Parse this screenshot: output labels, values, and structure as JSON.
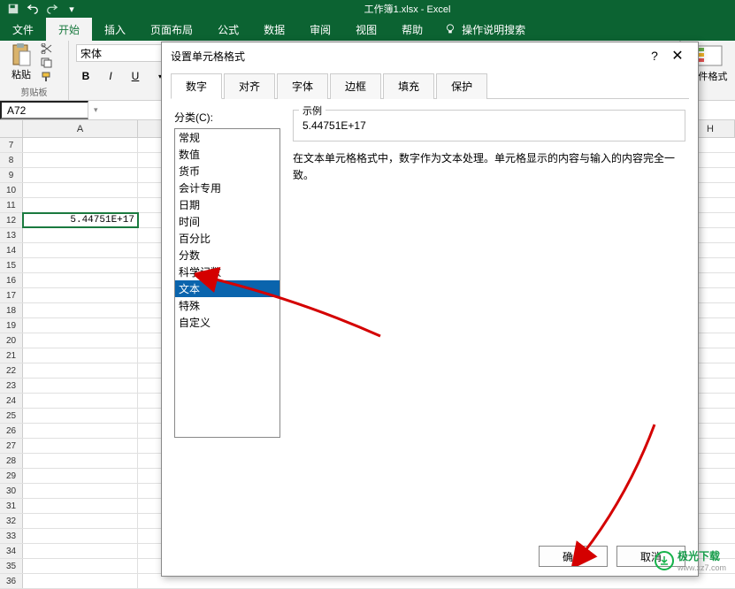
{
  "titlebar": {
    "doc_title": "工作簿1.xlsx - Excel"
  },
  "ribbon": {
    "tabs": [
      "文件",
      "开始",
      "插入",
      "页面布局",
      "公式",
      "数据",
      "审阅",
      "视图",
      "帮助"
    ],
    "active_tab": 1,
    "search_hint": "操作说明搜索",
    "clipboard": {
      "paste": "粘贴",
      "group_label": "剪贴板"
    },
    "font": {
      "name": "宋体",
      "bold": "B",
      "italic": "I",
      "underline": "U"
    },
    "cond_format": "条件格式"
  },
  "namebox": {
    "ref": "A72"
  },
  "grid": {
    "columns": [
      "A",
      "H"
    ],
    "rows": [
      7,
      8,
      9,
      10,
      11,
      12,
      13,
      14,
      15,
      16,
      17,
      18,
      19,
      20,
      21,
      22,
      23,
      24,
      25,
      26,
      27,
      28,
      29,
      30,
      31,
      32,
      33,
      34,
      35,
      36
    ],
    "cell_value": "5.44751E+17",
    "selected_row": 12
  },
  "dialog": {
    "title": "设置单元格格式",
    "tabs": [
      "数字",
      "对齐",
      "字体",
      "边框",
      "填充",
      "保护"
    ],
    "active_tab": 0,
    "category_label": "分类(C):",
    "categories": [
      "常规",
      "数值",
      "货币",
      "会计专用",
      "日期",
      "时间",
      "百分比",
      "分数",
      "科学记数",
      "文本",
      "特殊",
      "自定义"
    ],
    "selected_category": 9,
    "example_label": "示例",
    "example_value": "5.44751E+17",
    "description": "在文本单元格格式中，数字作为文本处理。单元格显示的内容与输入的内容完全一致。",
    "ok": "确定",
    "cancel": "取消"
  },
  "watermark": {
    "text": "极光下载",
    "url": "www.xz7.com"
  }
}
